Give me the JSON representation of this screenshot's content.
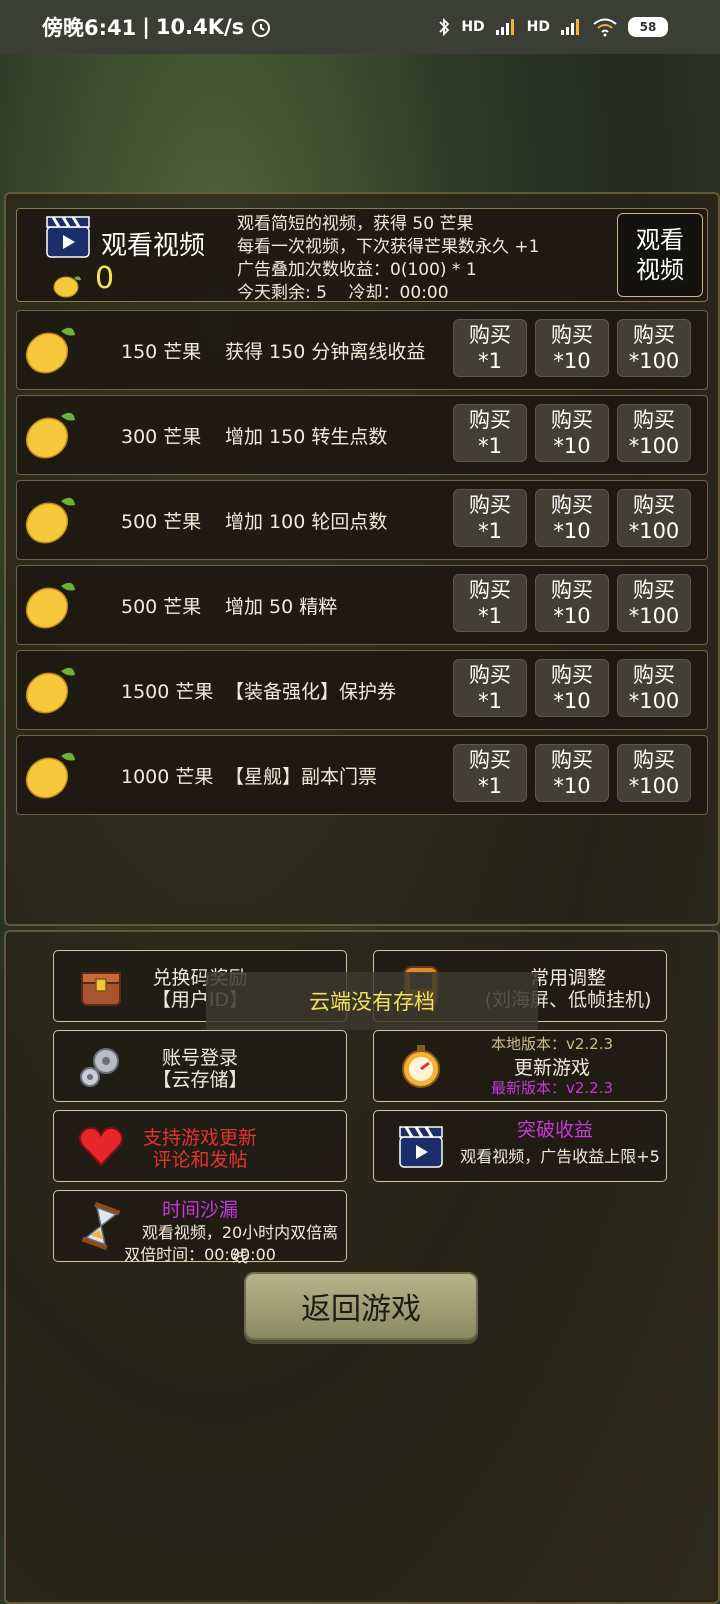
{
  "status_bar": {
    "time": "傍晚6:41",
    "speed": "10.4K/s",
    "battery": "58",
    "hd1": "HD",
    "hd2": "HD"
  },
  "video": {
    "title": "观看视频",
    "mango_count": "0",
    "desc_line1": "观看简短的视频，获得 50 芒果",
    "desc_line2": "每看一次视频，下次获得芒果数永久 +1",
    "desc_line3": "广告叠加次数收益：0(100) * 1",
    "desc_line4": "今天剩余: 5    冷却：00:00",
    "button_line1": "观看",
    "button_line2": "视频"
  },
  "shop": {
    "buy_label": "购买",
    "qty1": "*1",
    "qty10": "*10",
    "qty100": "*100",
    "rows": [
      {
        "price": "150 芒果",
        "desc": "获得 150 分钟离线收益"
      },
      {
        "price": "300 芒果",
        "desc": "增加 150 转生点数"
      },
      {
        "price": "500 芒果",
        "desc": "增加 100 轮回点数"
      },
      {
        "price": "500 芒果",
        "desc": "增加 50 精粹"
      },
      {
        "price": "1500 芒果",
        "desc": "【装备强化】保护券"
      },
      {
        "price": "1000 芒果",
        "desc": "【星舰】副本门票"
      }
    ]
  },
  "menu": {
    "redeem_title": "兑换码奖励",
    "redeem_sub": "【用户ID】",
    "settings_title": "常用调整",
    "settings_sub": "(刘海屏、低帧挂机)",
    "login_title": "账号登录",
    "login_sub": "【云存储】",
    "update_local": "本地版本：v2.2.3",
    "update_title": "更新游戏",
    "update_latest": "最新版本：v2.2.3",
    "support_line1": "支持游戏更新",
    "support_line2": "评论和发帖",
    "break_title": "突破收益",
    "break_desc": "观看视频，广告收益上限+5",
    "hourglass_title": "时间沙漏",
    "hourglass_desc": "观看视频，20小时内双倍离线",
    "hourglass_time": "双倍时间：00:00:00"
  },
  "toast": "云端没有存档",
  "back_button": "返回游戏"
}
